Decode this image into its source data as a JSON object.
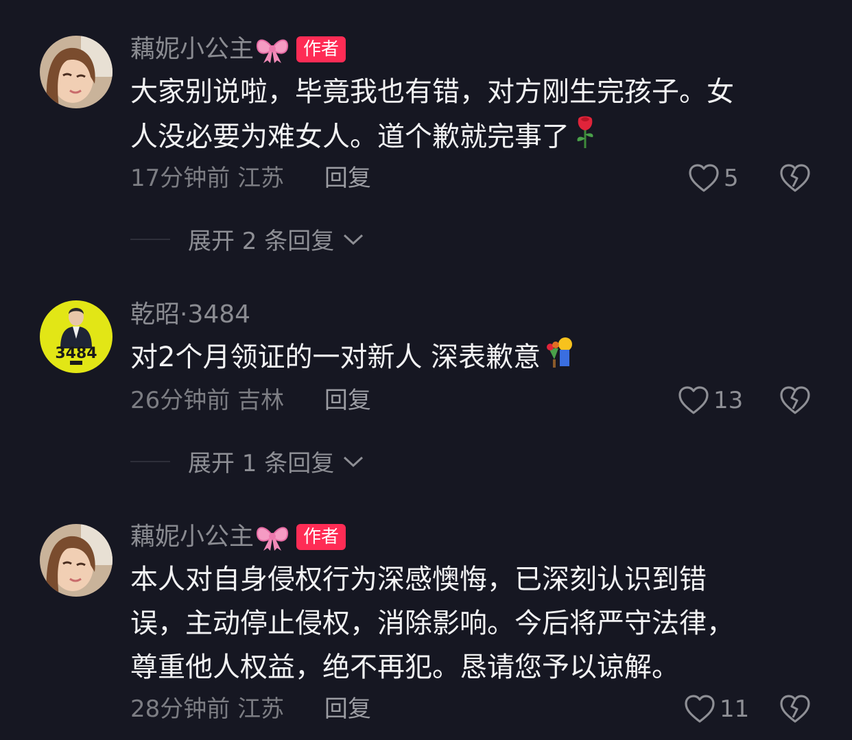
{
  "comments": [
    {
      "username": "藕妮小公主",
      "has_bow": true,
      "badge": "作者",
      "lines": [
        "大家别说啦，毕竟我也有错，对方刚生完孩子。女",
        "人没必要为难女人。道个歉就完事了"
      ],
      "trailing_emoji": "rose",
      "time": "17分钟前",
      "location": "江苏",
      "reply_label": "回复",
      "likes": "5",
      "expand_label": "展开 2 条回复"
    },
    {
      "username": "乾昭·3484",
      "avatar_text": "3484",
      "lines": [
        "对2个月领证的一对新人 深表歉意"
      ],
      "trailing_emoji": "bouquet-person",
      "time": "26分钟前",
      "location": "吉林",
      "reply_label": "回复",
      "likes": "13",
      "expand_label": "展开 1 条回复"
    },
    {
      "username": "藕妮小公主",
      "has_bow": true,
      "badge": "作者",
      "lines": [
        "本人对自身侵权行为深感懊悔，已深刻认识到错",
        "误，主动停止侵权，消除影响。今后将严守法律，",
        "尊重他人权益，绝不再犯。恳请您予以谅解。"
      ],
      "time": "28分钟前",
      "location": "江苏",
      "reply_label": "回复",
      "likes": "11"
    }
  ],
  "icons": {
    "like": "heart-outline-icon",
    "dislike": "broken-heart-icon",
    "expand": "chevron-down-icon"
  },
  "colors": {
    "background": "#161722",
    "badge": "#fe2c55",
    "text": "#f2f2f3",
    "muted": "#7c7d83"
  }
}
